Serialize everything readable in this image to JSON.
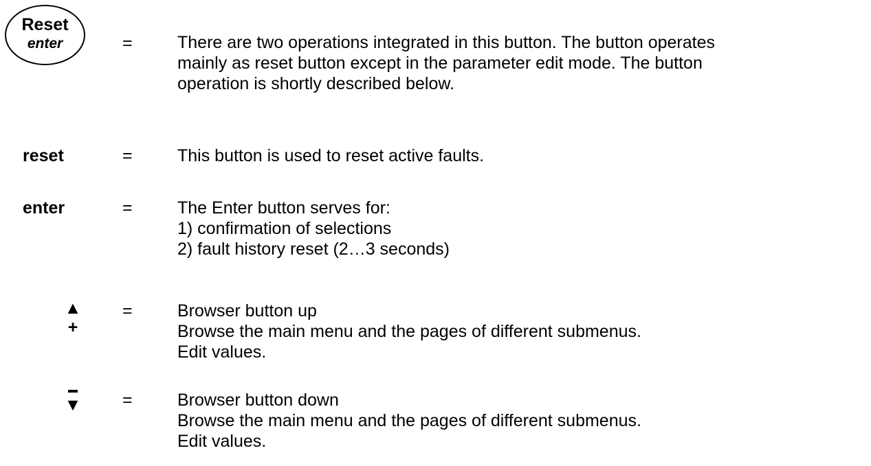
{
  "keys": {
    "reset_enter": {
      "label_top": "Reset",
      "label_bottom": "enter",
      "equals": "=",
      "lines": [
        "There are two operations integrated in this button. The button operates",
        "mainly as reset button except in the parameter edit mode. The button",
        "operation is shortly described below."
      ]
    },
    "reset": {
      "label": "reset",
      "equals": "=",
      "lines": [
        "This button is used to reset active faults."
      ]
    },
    "enter": {
      "label": "enter",
      "equals": "=",
      "lines": [
        "The Enter button serves for:",
        "1) confirmation of selections",
        "2) fault history reset (2…3 seconds)"
      ]
    },
    "browser_up": {
      "symbol_top": "▲",
      "symbol_bottom": "+",
      "equals": "=",
      "lines": [
        "Browser button up",
        "Browse the main menu and the pages of different submenus.",
        "Edit values."
      ]
    },
    "browser_down": {
      "symbol_bottom": "▼",
      "equals": "=",
      "lines": [
        "Browser button down",
        "Browse the main menu and the pages of different submenus.",
        "Edit values."
      ]
    }
  }
}
